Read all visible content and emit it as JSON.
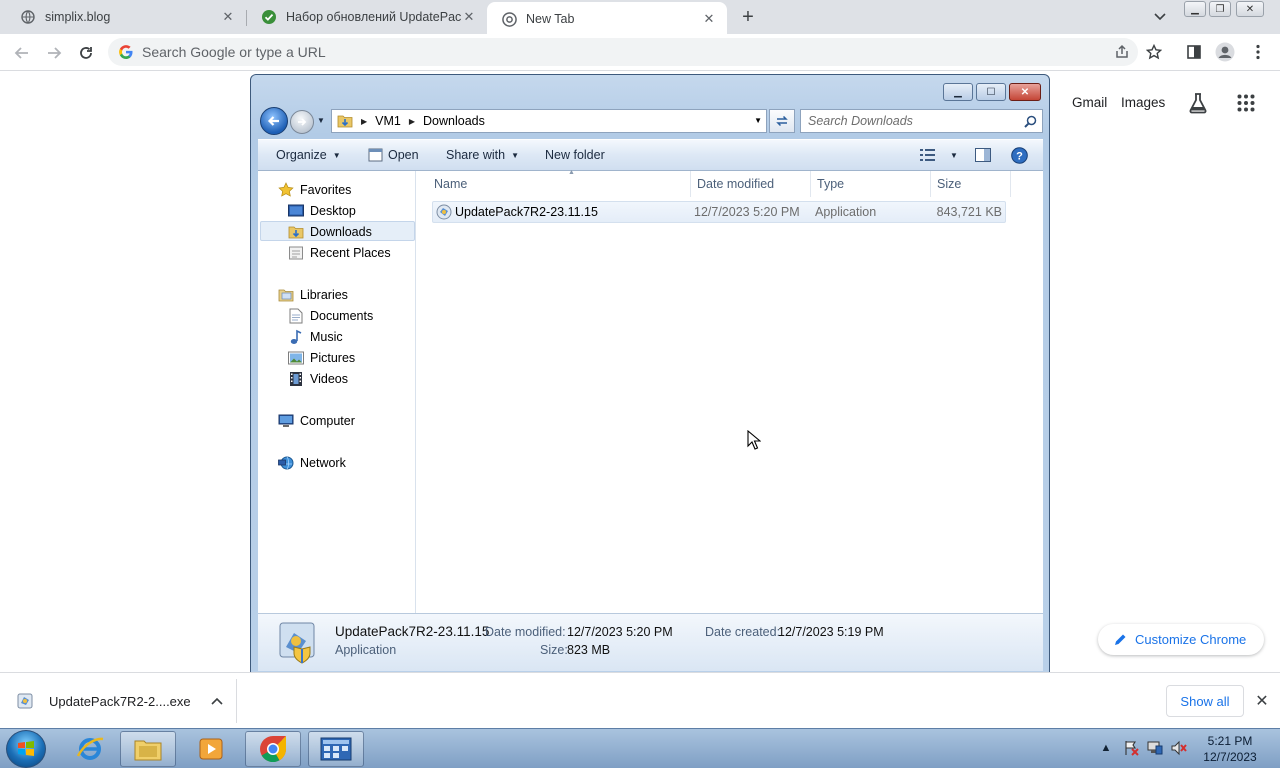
{
  "browser": {
    "tabs": [
      {
        "title": "simplix.blog",
        "active": false
      },
      {
        "title": "Набор обновлений UpdatePack",
        "active": false
      },
      {
        "title": "New Tab",
        "active": true
      }
    ],
    "omnibox_placeholder": "Search Google or type a URL",
    "ntp_links": {
      "gmail": "Gmail",
      "images": "Images"
    },
    "customize_label": "Customize Chrome"
  },
  "explorer": {
    "breadcrumb": [
      "VM1",
      "Downloads"
    ],
    "search_placeholder": "Search Downloads",
    "commands": {
      "organize": "Organize",
      "open": "Open",
      "share_with": "Share with",
      "new_folder": "New folder"
    },
    "nav": {
      "favorites": "Favorites",
      "desktop": "Desktop",
      "downloads": "Downloads",
      "recent_places": "Recent Places",
      "libraries": "Libraries",
      "documents": "Documents",
      "music": "Music",
      "pictures": "Pictures",
      "videos": "Videos",
      "computer": "Computer",
      "network": "Network"
    },
    "columns": {
      "name": "Name",
      "date_modified": "Date modified",
      "type": "Type",
      "size": "Size"
    },
    "files": [
      {
        "name": "UpdatePack7R2-23.11.15",
        "date_modified": "12/7/2023 5:20 PM",
        "type": "Application",
        "size": "843,721 KB"
      }
    ],
    "details": {
      "name": "UpdatePack7R2-23.11.15",
      "type": "Application",
      "date_modified_label": "Date modified:",
      "date_modified": "12/7/2023 5:20 PM",
      "date_created_label": "Date created:",
      "date_created": "12/7/2023 5:19 PM",
      "size_label": "Size:",
      "size": "823 MB"
    }
  },
  "download_bar": {
    "filename": "UpdatePack7R2-2....exe",
    "show_all": "Show all"
  },
  "taskbar": {
    "time": "5:21 PM",
    "date": "12/7/2023"
  },
  "colors": {
    "accent_blue": "#1a73e8",
    "tabstrip": "#dee1e6",
    "taskbar": "#8aa8cc"
  }
}
